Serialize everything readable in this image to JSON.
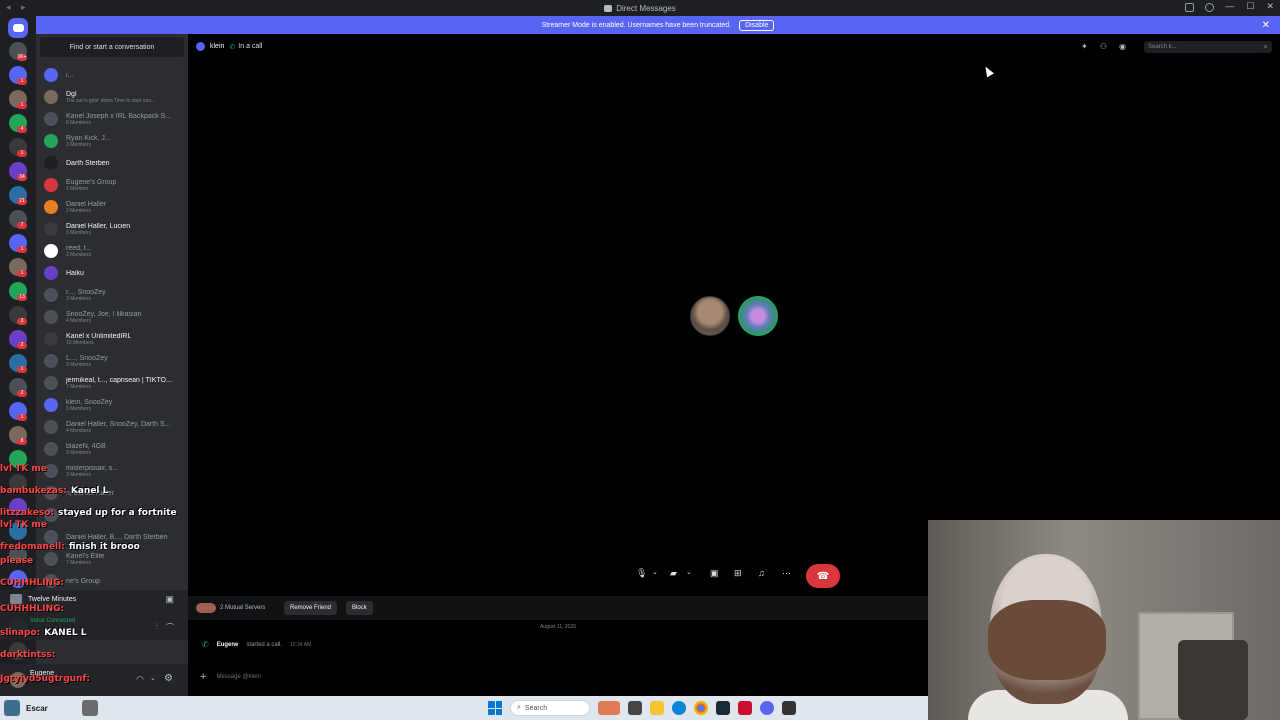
{
  "titlebar": {
    "title": "Direct Messages"
  },
  "banner": {
    "text": "Streamer Mode is enabled. Usernames have been truncated.",
    "button": "Disable",
    "close": "✕"
  },
  "sidebar": {
    "find": "Find or start a conversation",
    "dms": [
      {
        "name": "i...",
        "sub": "",
        "bold": false,
        "color": "#5865f2"
      },
      {
        "name": "Dgl",
        "sub": "The sun's goin' down Time to start you...",
        "bold": true,
        "color": "#7a6a5e"
      },
      {
        "name": "Kanel Joseph x IRL Backpack S...",
        "sub": "8 Members",
        "bold": false,
        "color": "#4e5058"
      },
      {
        "name": "Ryan Kick, J...",
        "sub": "3 Members",
        "bold": false,
        "color": "#23a55a"
      },
      {
        "name": "Darth Sterben",
        "sub": "",
        "bold": true,
        "color": "#1e1f22"
      },
      {
        "name": "Eugene's Group",
        "sub": "1 Member",
        "bold": false,
        "color": "#da373c"
      },
      {
        "name": "Daniel Haller",
        "sub": "2 Members",
        "bold": false,
        "color": "#e67e22"
      },
      {
        "name": "Daniel Haller, Lucien",
        "sub": "3 Members",
        "bold": true,
        "color": "#3a3a3a"
      },
      {
        "name": "reed, t...",
        "sub": "3 Members",
        "bold": false,
        "color": "#ffffff"
      },
      {
        "name": "Haiku",
        "sub": "",
        "bold": true,
        "color": "#6a3fc8"
      },
      {
        "name": "r..., SnooZey",
        "sub": "3 Members",
        "bold": false,
        "color": "#4e5058"
      },
      {
        "name": "SnooZey, Joe, ! lilkasian",
        "sub": "4 Members",
        "bold": false,
        "color": "#4e5058"
      },
      {
        "name": "Kanel x UnlimitedIRL",
        "sub": "10 Members",
        "bold": true,
        "color": "#3a3a3a"
      },
      {
        "name": "L..., SnooZey",
        "sub": "3 Members",
        "bold": false,
        "color": "#4e5058"
      },
      {
        "name": "jermikeal, t..., caprisean | TIKTO...",
        "sub": "7 Members",
        "bold": true,
        "color": "#4e5058"
      },
      {
        "name": "klein, SnooZey",
        "sub": "3 Members",
        "bold": false,
        "color": "#5865f2"
      },
      {
        "name": "Daniel Haller, SnooZey, Darth S...",
        "sub": "4 Members",
        "bold": false,
        "color": "#4e5058"
      },
      {
        "name": "blazeN, 4GB",
        "sub": "3 Members",
        "bold": false,
        "color": "#4e5058"
      },
      {
        "name": "misterpissair, s...",
        "sub": "3 Members",
        "bold": false,
        "color": "#4e5058"
      },
      {
        "name": "n, Daniel Haller",
        "sub": "",
        "bold": false,
        "color": "#4e5058"
      },
      {
        "name": "",
        "sub": "3 Members",
        "bold": false,
        "color": "#4e5058"
      },
      {
        "name": "Daniel Haller, B..., Darth Sterben",
        "sub": "",
        "bold": false,
        "color": "#4e5058"
      },
      {
        "name": "Kanel's Elite",
        "sub": "7 Members",
        "bold": false,
        "color": "#4e5058"
      },
      {
        "name": "ne's Group",
        "sub": "",
        "bold": false,
        "color": "#4e5058"
      }
    ],
    "voice_activity": "Twelve Minutes",
    "voice_status": "Voice Connected",
    "user_name": "Eugene"
  },
  "chat_overlay": [
    {
      "user": "lvl TK me",
      "msg": ""
    },
    {
      "user": "bambukezas:",
      "msg": "Kanel L"
    },
    {
      "user": "litzzakeso:",
      "msg": "stayed up for a fortnite"
    },
    {
      "user": "lvl TK me",
      "msg": ""
    },
    {
      "user": "fredomanell:",
      "msg": "finish it brooo"
    },
    {
      "user": "please",
      "msg": ""
    },
    {
      "user": "CUHHHLING:",
      "msg": ""
    },
    {
      "user": "CUHHHLING:",
      "msg": ""
    },
    {
      "user": "slinapo:",
      "msg": "KANEL L"
    },
    {
      "user": "darktintss:",
      "msg": ""
    },
    {
      "user": "Jgtyiyd5ugtrgunf:",
      "msg": ""
    }
  ],
  "header": {
    "channel": "klein",
    "status": "In a call",
    "search_placeholder": "Search k..."
  },
  "profile_strip": {
    "mutual": "2 Mutual Servers",
    "remove_friend": "Remove Friend",
    "block": "Block"
  },
  "messages": {
    "date": "August 11, 2026",
    "caller": "Eugene",
    "action": "started a call.",
    "time": "12:34 AM"
  },
  "composer": {
    "placeholder": "Message @klein"
  },
  "taskbar": {
    "app_name": "Escar",
    "search": "Search"
  },
  "rail": {
    "badges": [
      "1K+",
      "1",
      "1",
      "4",
      "1",
      "34",
      "21",
      "7",
      "1",
      "1",
      "13",
      "3",
      "2",
      "1",
      "2",
      "1",
      "8"
    ]
  },
  "colors": {
    "accent": "#5865f2",
    "danger": "#da373c",
    "online": "#23a55a"
  }
}
